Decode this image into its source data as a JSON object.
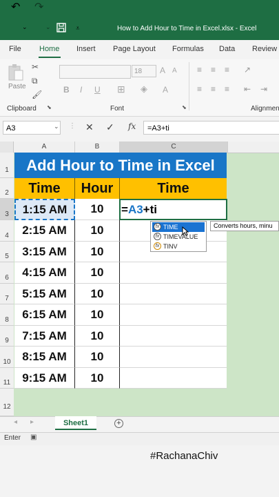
{
  "titlebar": {
    "title": "How to Add Hour to Time in Excel.xlsx  -  Excel"
  },
  "menu": {
    "tabs": [
      "File",
      "Home",
      "Insert",
      "Page Layout",
      "Formulas",
      "Data",
      "Review"
    ],
    "active": "Home"
  },
  "ribbon": {
    "paste_label": "Paste",
    "font_size": "18",
    "group_clipboard": "Clipboard",
    "group_font": "Font",
    "group_alignment": "Alignmen"
  },
  "formula_bar": {
    "name_box": "A3",
    "fx_label": "fx",
    "formula": "=A3+ti"
  },
  "grid": {
    "columns": [
      "A",
      "B",
      "C"
    ],
    "rows": [
      "1",
      "2",
      "3",
      "4",
      "5",
      "6",
      "7",
      "8",
      "9",
      "10",
      "11",
      "12"
    ],
    "title": "Add Hour to Time in Excel",
    "headers": {
      "time": "Time",
      "hour": "Hour",
      "result": "Time"
    },
    "data": [
      {
        "time": "1:15 AM",
        "hour": "10"
      },
      {
        "time": "2:15 AM",
        "hour": "10"
      },
      {
        "time": "3:15 AM",
        "hour": "10"
      },
      {
        "time": "4:15 AM",
        "hour": "10"
      },
      {
        "time": "5:15 AM",
        "hour": "10"
      },
      {
        "time": "6:15 AM",
        "hour": "10"
      },
      {
        "time": "7:15 AM",
        "hour": "10"
      },
      {
        "time": "8:15 AM",
        "hour": "10"
      },
      {
        "time": "9:15 AM",
        "hour": "10"
      }
    ],
    "edit": {
      "prefix": "=",
      "ref": "A3",
      "suffix": "+ti"
    }
  },
  "autocomplete": {
    "items": [
      "TIME",
      "TIMEVALUE",
      "TINV"
    ],
    "tooltip": "Converts hours, minu"
  },
  "sheets": {
    "active": "Sheet1"
  },
  "status": {
    "mode": "Enter"
  },
  "watermark": "#RachanaChiv",
  "colors": {
    "excel_green": "#1e6e43",
    "title_blue": "#1976c7",
    "header_gold": "#ffc000",
    "sheet_bg": "#cde5c7"
  }
}
